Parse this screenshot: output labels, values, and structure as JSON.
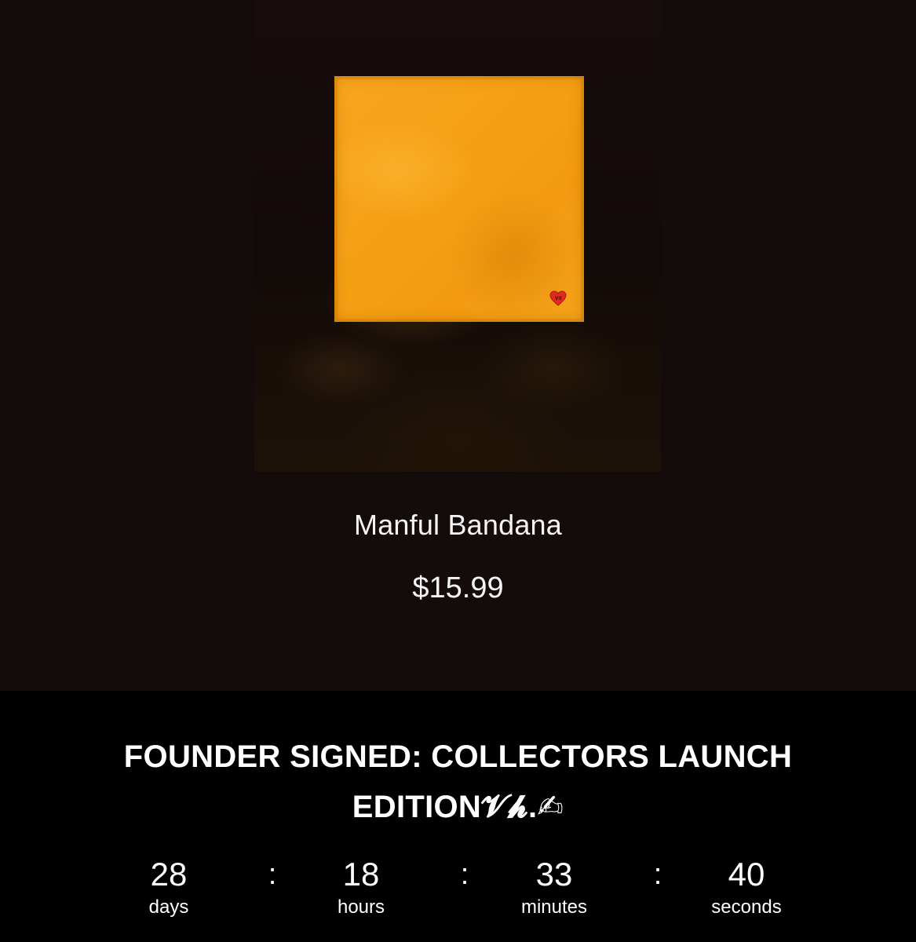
{
  "product": {
    "title": "Manful Bandana",
    "price": "$15.99",
    "image": {
      "alt": "Orange bandana with small red heart patch",
      "bandana_color": "#f5a013",
      "heart_color": "#e02a1e"
    }
  },
  "launch": {
    "title": "FOUNDER SIGNED: COLLECTORS LAUNCH EDITION",
    "signature_suffix": "𝓥𝓱.✍"
  },
  "countdown": {
    "separator": ":",
    "units": [
      {
        "value": "28",
        "label": "days"
      },
      {
        "value": "18",
        "label": "hours"
      },
      {
        "value": "33",
        "label": "minutes"
      },
      {
        "value": "40",
        "label": "seconds"
      }
    ]
  },
  "colors": {
    "page_background": "#140b0b",
    "banner_background": "#000000",
    "text": "#ffffff"
  }
}
